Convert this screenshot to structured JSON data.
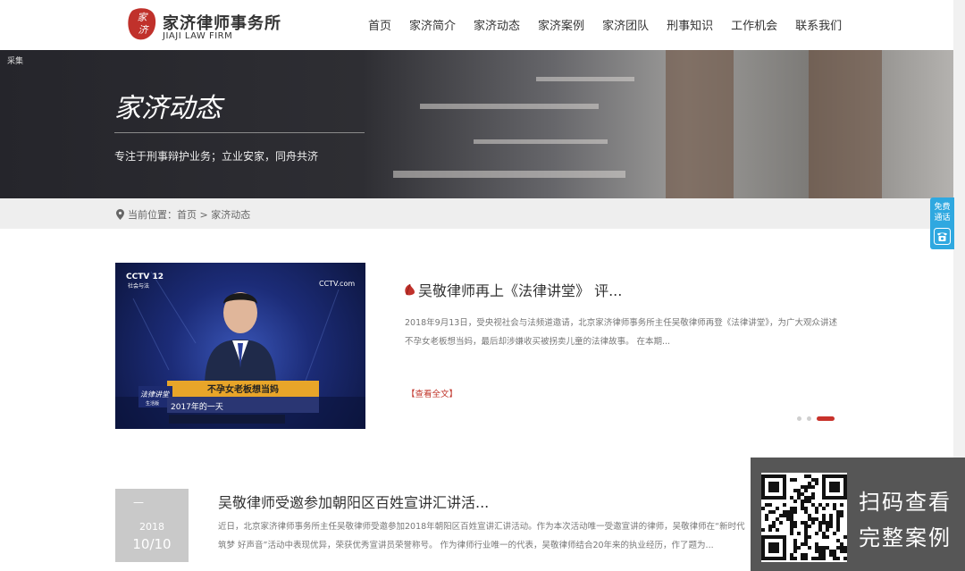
{
  "header": {
    "logo_seal_text": "家济",
    "logo_cn": "家济律师事务所",
    "logo_en": "JIAJI LAW FIRM",
    "nav": [
      "首页",
      "家济简介",
      "家济动态",
      "家济案例",
      "家济团队",
      "刑事知识",
      "工作机会",
      "联系我们"
    ]
  },
  "banner": {
    "tag": "采集",
    "title": "家济动态",
    "subtitle": "专注于刑事辩护业务；立业安家，同舟共济"
  },
  "breadcrumb": {
    "text": "当前位置：首页 > 家济动态"
  },
  "side_consult": {
    "line1": "免费",
    "line2": "通话"
  },
  "featured": {
    "image": {
      "logo_left": "CCTV 12",
      "channel": "社会与法",
      "logo_right": "CCTV.com",
      "show_logo": "法律讲堂",
      "show_sub": "生活版",
      "caption": "不孕女老板想当妈",
      "episode": "2017年的一天"
    },
    "title": "吴敬律师再上《法律讲堂》 评...",
    "desc": "2018年9月13日，受央视社会与法频道邀请，北京家济律师事务所主任吴敬律师再登《法律讲堂》，为广大观众讲述不孕女老板想当妈，最后却涉嫌收买被拐卖儿童的法律故事。 在本期...",
    "more": "【查看全文】"
  },
  "news_item": {
    "dash": "—",
    "year": "2018",
    "month_day": "10/10",
    "title": "吴敬律师受邀参加朝阳区百姓宣讲汇讲活...",
    "desc": "近日，北京家济律师事务所主任吴敬律师受邀参加2018年朝阳区百姓宣讲汇讲活动。作为本次活动唯一受邀宣讲的律师，吴敬律师在“新时代 筑梦 好声音”活动中表现优异，荣获优秀宣讲员荣誉称号。 作为律师行业唯一的代表，吴敬律师结合20年来的执业经历，作了题为..."
  },
  "qr_overlay": {
    "line1": "扫码查看",
    "line2": "完整案例"
  },
  "colors": {
    "accent_red": "#c8322b",
    "consult_blue": "#2fa8e0",
    "overlay_gray": "#565656"
  }
}
